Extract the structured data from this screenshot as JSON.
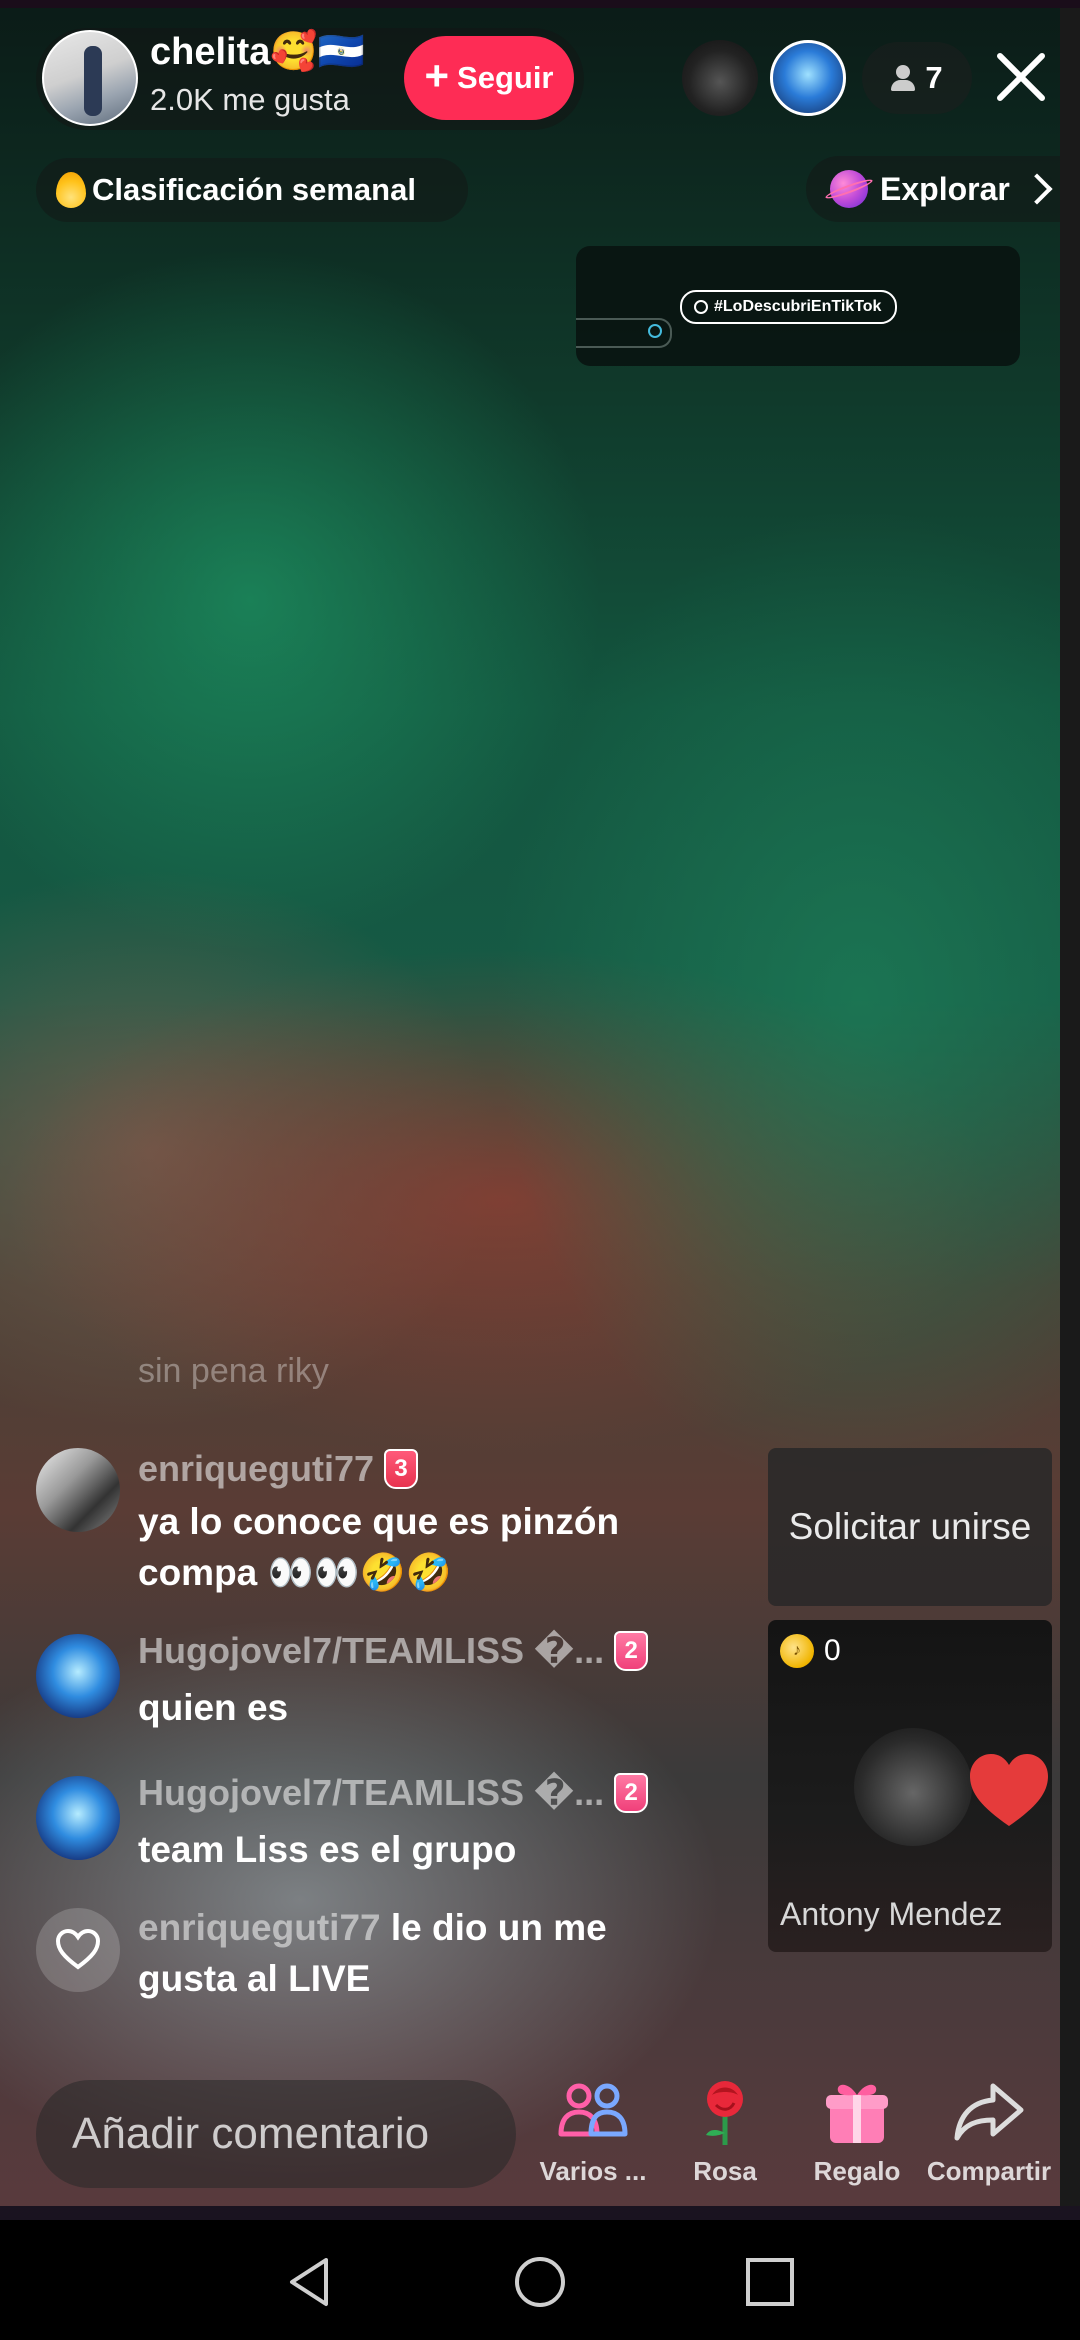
{
  "header": {
    "host_name": "chelita🥰🇸🇻",
    "host_likes": "2.0K me gusta",
    "follow_label": "Seguir",
    "viewer_count": "7"
  },
  "chips": {
    "ranking_label": "Clasificación semanal",
    "explore_label": "Explorar"
  },
  "promo": {
    "hashtag": "#LoDescubriEnTikTok"
  },
  "comments": {
    "faded": "sin pena riky",
    "items": [
      {
        "user": "enriqueguti77",
        "badge": "3",
        "text": "ya lo conoce que es pinzón compa 👀👀🤣🤣"
      },
      {
        "user": "Hugojovel7/TEAMLISS �...",
        "badge": "2",
        "text": "quien es"
      },
      {
        "user": "Hugojovel7/TEAMLISS �...",
        "badge": "2",
        "text": "team Liss es el grupo"
      },
      {
        "user": "enriqueguti77",
        "text": "le dio un me gusta al LIVE"
      }
    ]
  },
  "side": {
    "join_label": "Solicitar unirse",
    "coin_count": "0",
    "guest_name": "Antony Mendez"
  },
  "bottom": {
    "comment_placeholder": "Añadir comentario",
    "actions": [
      {
        "label": "Varios ...",
        "icon": "multi-guest-icon"
      },
      {
        "label": "Rosa",
        "icon": "rose-icon"
      },
      {
        "label": "Regalo",
        "icon": "gift-icon"
      },
      {
        "label": "Compartir",
        "icon": "share-icon"
      }
    ]
  },
  "colors": {
    "accent": "#fe2c55"
  }
}
